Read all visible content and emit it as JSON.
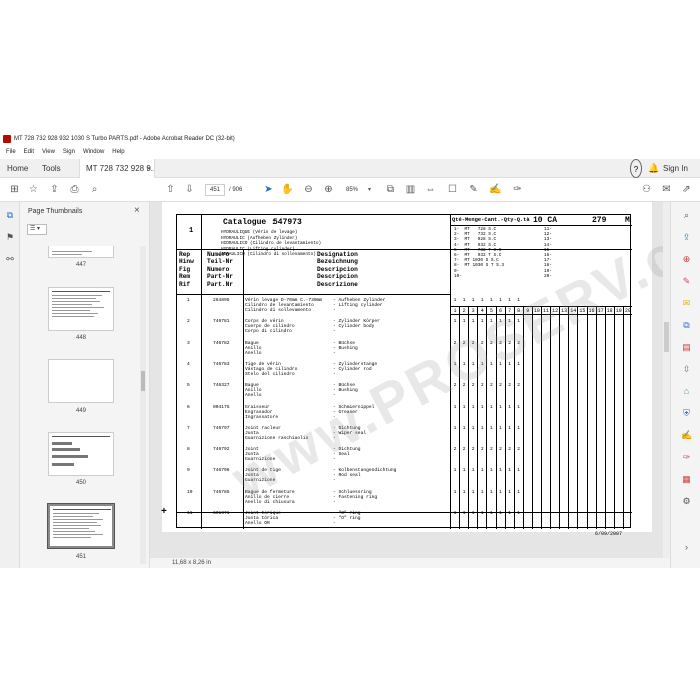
{
  "window": {
    "title": "MT 728 732 928 932 1030 S Turbo PARTS.pdf - Adobe Acrobat Reader DC (32-bit)"
  },
  "menu": [
    "File",
    "Edit",
    "View",
    "Sign",
    "Window",
    "Help"
  ],
  "tabs": {
    "home": "Home",
    "tools": "Tools",
    "document": "MT 728 732 928 9...",
    "close": "×"
  },
  "header_right": {
    "help": "?",
    "bell": "🔔",
    "signin": "Sign In"
  },
  "toolbar": {
    "page_current": "451",
    "page_total": "/ 906",
    "zoom": "85%",
    "zoom_arrow": "▾"
  },
  "thumbnails": {
    "title": "Page Thumbnails",
    "close": "×",
    "options": "☰ ▾",
    "pages": [
      {
        "label": "447"
      },
      {
        "label": "448"
      },
      {
        "label": "449"
      },
      {
        "label": "450"
      },
      {
        "label": "451"
      }
    ]
  },
  "status": {
    "page_size": "11,68 x 8,26 in"
  },
  "document": {
    "watermark": "www.PROSERV.com",
    "catalogue_label": "Catalogue :",
    "catalogue_number": "547973",
    "item_top": "1",
    "header_lines": "HYDRAULIQUE (Vérin de levage)\nHYDRAULIC (Aufheben Zylinder)\nHIDRAULICO (Cilindro de levantamiento)\nHYDRAULIC (Lifting cylinder)\nIDRAULICO (Cilindro di sollevamento)",
    "col_rep": "Rep\nHinw\nFig\nRem\nRif",
    "col_numero": "Numéro\nTeil-Nr\nNumero\nPart-Nr\nPart.Nr",
    "col_designation": "Designation\nBezeichnung\nDescripcion\nDescripcion\nDescrizione",
    "qty_header": "Qté-Menge-Cant.-Qty-Q.tà",
    "model_code": "10 CA",
    "model_page": "279",
    "model_letter": "M",
    "variants_left": "1-  MT   728 S.C\n2-  MT   732 S.C\n3-  MT   928 S.C\n4-  MT   932 S.C\n5-  MT   732 T S.C\n6-  MT   932 T S.C\n7-  MT 1030 S S.C\n8-  MT 1030 S T S.3\n9-\n10-",
    "variants_right": "11-\n12-\n13-\n14-\n15-\n16-\n17-\n18-\n19-\n20-",
    "qty_columns": [
      "1",
      "2",
      "3",
      "4",
      "5",
      "6",
      "7",
      "8",
      "9",
      "10",
      "11",
      "12",
      "13",
      "14",
      "15",
      "16",
      "17",
      "18",
      "19",
      "20"
    ],
    "date": "6/09/2007",
    "plus": "+",
    "parts": [
      {
        "rep": "1",
        "pn": "264895",
        "desc": "Vérin levage D-70mm C.-730mm\nCilindro de levantamiento\nCilindro di sollevamento",
        "des": "- Aufheben Zylinder\n- Lifting cylinder\n-",
        "qty": [
          "1",
          "1",
          "1",
          "1",
          "1",
          "1",
          "1",
          "1"
        ]
      },
      {
        "rep": "2",
        "pn": "746781",
        "desc": "Corps de vérin\nCuerpo de cilindro\nCorpo di cilindro",
        "des": "- Zylinder Körper\n- Cylinder body\n-",
        "qty": [
          "1",
          "1",
          "1",
          "1",
          "1",
          "1",
          "1",
          "1"
        ]
      },
      {
        "rep": "3",
        "pn": "746782",
        "desc": "Bague\nAnillo\nAnello",
        "des": "- Büchse\n- Bushing\n-",
        "qty": [
          "2",
          "2",
          "2",
          "2",
          "2",
          "2",
          "2",
          "2"
        ]
      },
      {
        "rep": "4",
        "pn": "746783",
        "desc": "Tige de vérin\nVástago de cilindro\nStelo del cilindro",
        "des": "- Zylinderstange\n- Cylinder rod\n-",
        "qty": [
          "1",
          "1",
          "1",
          "1",
          "1",
          "1",
          "1",
          "1"
        ]
      },
      {
        "rep": "5",
        "pn": "746327",
        "desc": "Bague\nAnillo\nAnello",
        "des": "- Büchse\n- Bushing\n-",
        "qty": [
          "2",
          "2",
          "2",
          "2",
          "2",
          "2",
          "2",
          "2"
        ]
      },
      {
        "rep": "6",
        "pn": "004175",
        "desc": "Graisseur\nEngrasador\nIngrassatore",
        "des": "- Schmiernippel\n- Greaser\n-",
        "qty": [
          "1",
          "1",
          "1",
          "1",
          "1",
          "1",
          "1",
          "1"
        ]
      },
      {
        "rep": "7",
        "pn": "746797",
        "desc": "Joint racleur\nJunta\nGuarnizione raschiaolio",
        "des": "- Dichtung\n- Wiper seal\n-",
        "qty": [
          "1",
          "1",
          "1",
          "1",
          "1",
          "1",
          "1",
          "1"
        ]
      },
      {
        "rep": "8",
        "pn": "746792",
        "desc": "Joint\nJunta\nGuarnizione",
        "des": "- Dichtung\n- Seal\n-",
        "qty": [
          "2",
          "2",
          "2",
          "2",
          "2",
          "2",
          "2",
          "2"
        ]
      },
      {
        "rep": "9",
        "pn": "746796",
        "desc": "Joint de tige\nJunta\nGuarnizione",
        "des": "- Kolbenstangendichtung\n- Rod seal\n-",
        "qty": [
          "1",
          "1",
          "1",
          "1",
          "1",
          "1",
          "1",
          "1"
        ]
      },
      {
        "rep": "10",
        "pn": "746785",
        "desc": "Bague de fermeture\nAnillo de cierre\nAnello di chiusura",
        "des": "- Schluessring\n- Fastening ring\n-",
        "qty": [
          "1",
          "1",
          "1",
          "1",
          "1",
          "1",
          "1",
          "1"
        ]
      },
      {
        "rep": "11",
        "pn": "601071",
        "desc": "Joint torique\nJunta tórica\nAnello OR",
        "des": "- \"O\" ring\n- \"O\" ring\n-",
        "qty": [
          "1",
          "1",
          "1",
          "1",
          "1",
          "1",
          "1",
          "1"
        ]
      }
    ]
  }
}
